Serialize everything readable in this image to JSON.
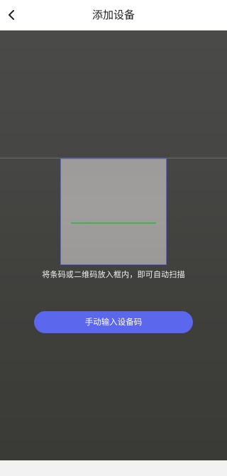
{
  "header": {
    "title": "添加设备",
    "back_icon": "chevron-left-icon"
  },
  "scanner": {
    "hint": "将条码或二维码放入框内，即可自动扫描",
    "frame_color": "#5e66e6",
    "scan_line_color": "#3fb24f"
  },
  "actions": {
    "manual_input_label": "手动输入设备码",
    "button_color": "#5b67ec"
  }
}
